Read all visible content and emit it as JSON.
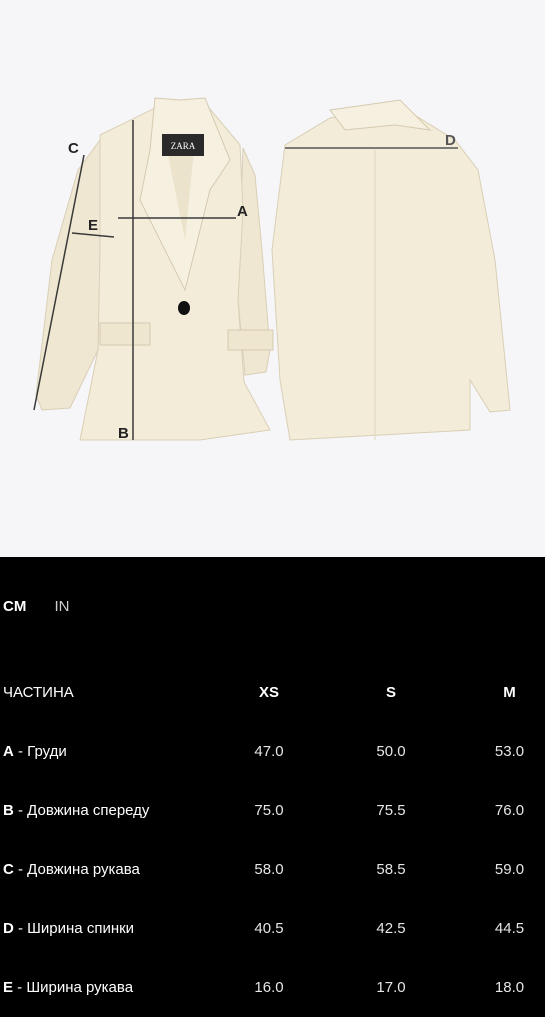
{
  "product_image": {
    "brand_label": "ZARA",
    "markers": [
      "A",
      "B",
      "C",
      "D",
      "E"
    ]
  },
  "unit_tabs": [
    {
      "label": "CM",
      "active": true
    },
    {
      "label": "IN",
      "active": false
    }
  ],
  "table": {
    "headers": [
      "ЧАСТИНА",
      "XS",
      "S",
      "M"
    ],
    "rows": [
      {
        "letter": "A",
        "part": " - Груди",
        "values": [
          "47.0",
          "50.0",
          "53.0"
        ]
      },
      {
        "letter": "B",
        "part": " - Довжина спереду",
        "values": [
          "75.0",
          "75.5",
          "76.0"
        ]
      },
      {
        "letter": "C",
        "part": " - Довжина рукава",
        "values": [
          "58.0",
          "58.5",
          "59.0"
        ]
      },
      {
        "letter": "D",
        "part": " - Ширина спинки",
        "values": [
          "40.5",
          "42.5",
          "44.5"
        ]
      },
      {
        "letter": "E",
        "part": " - Ширина рукава",
        "values": [
          "16.0",
          "17.0",
          "18.0"
        ]
      }
    ]
  },
  "colors": {
    "background": "#000000",
    "photo_background": "#f6f6f8",
    "garment": "#f3ecd9",
    "measure_line": "#3a3a3a",
    "back_measure_line": "#555555"
  }
}
